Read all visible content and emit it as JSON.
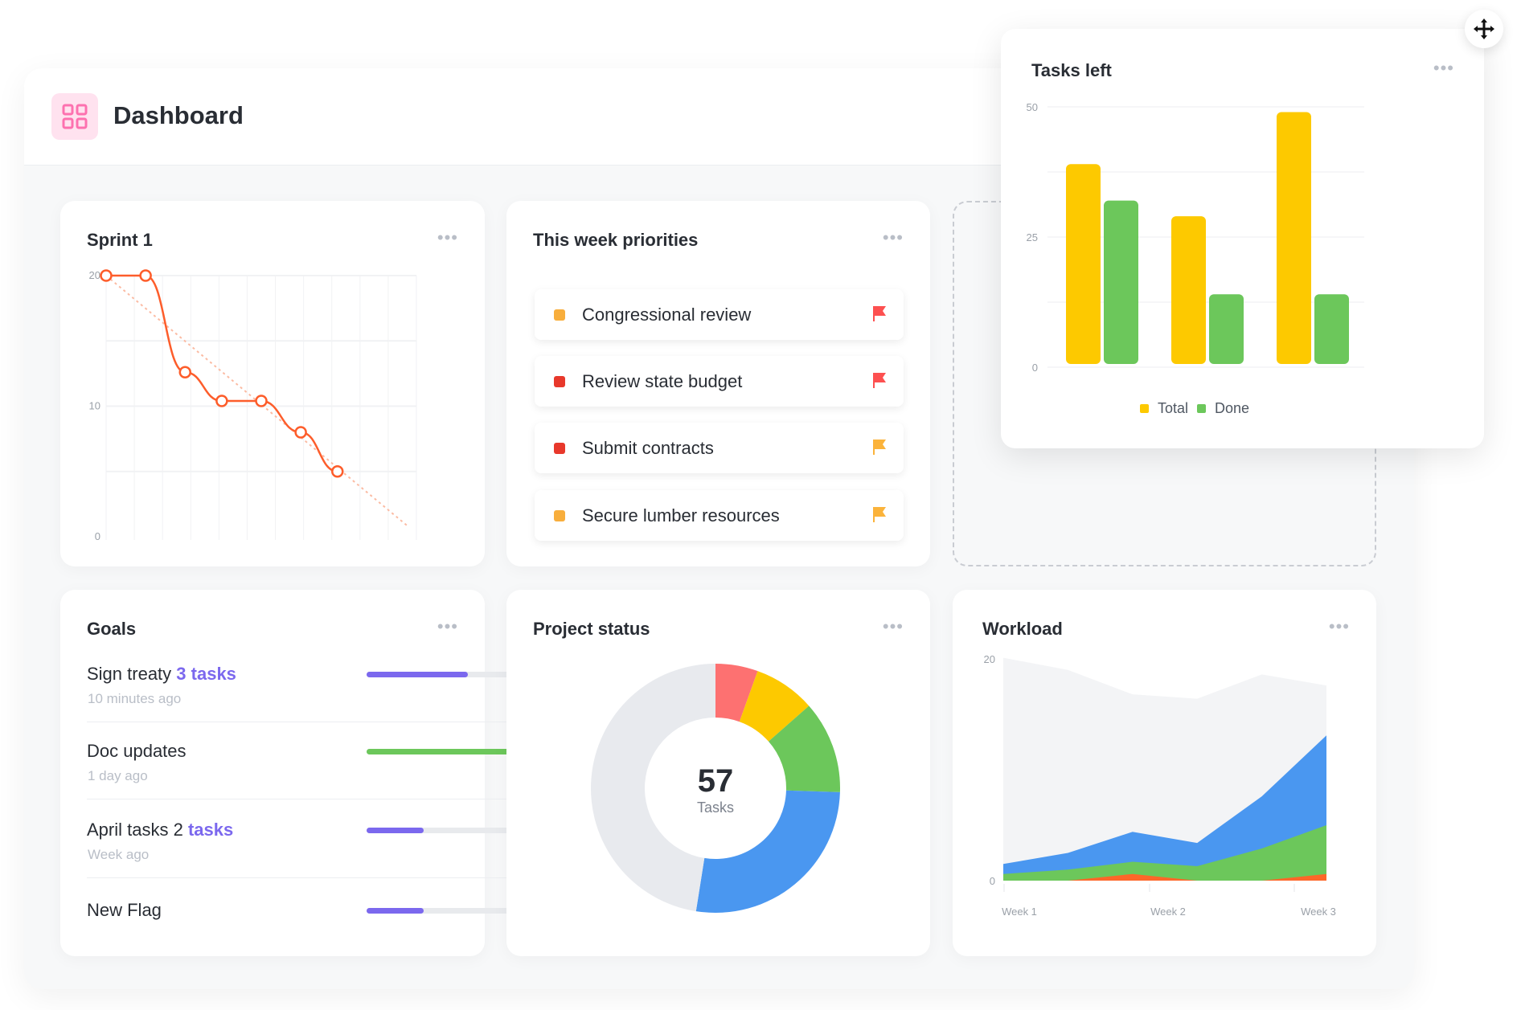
{
  "header": {
    "title": "Dashboard",
    "icon": "dashboard-grid-icon",
    "icon_color": "#fd71af"
  },
  "sprint": {
    "title": "Sprint 1",
    "menu": "•••",
    "chart_data": {
      "type": "line",
      "title": "Sprint 1",
      "yticks": [
        "0",
        "10",
        "20"
      ],
      "ylim": [
        0,
        20
      ],
      "xlim": [
        0,
        11
      ],
      "x": [
        0,
        1.4,
        2.8,
        4.1,
        5.5,
        6.9,
        8.2
      ],
      "y": [
        20,
        20,
        12.6,
        10.4,
        10.4,
        8,
        5
      ],
      "ideal": {
        "x": [
          0,
          10.7
        ],
        "y": [
          20,
          0.8
        ]
      },
      "color": "#fd5d2b",
      "grid": true
    }
  },
  "priorities": {
    "title": "This week priorities",
    "menu": "•••",
    "items": [
      {
        "label": "Congressional review",
        "status_color": "#f8ae3c",
        "flag_color": "#fd5050"
      },
      {
        "label": "Review state budget",
        "status_color": "#e8382b",
        "flag_color": "#fd5050"
      },
      {
        "label": "Submit contracts",
        "status_color": "#e8382b",
        "flag_color": "#fbb33b"
      },
      {
        "label": "Secure lumber resources",
        "status_color": "#f8ae3c",
        "flag_color": "#fbb33b"
      }
    ]
  },
  "tasks_left": {
    "title": "Tasks left",
    "menu": "•••",
    "chart_data": {
      "type": "bar",
      "categories": [
        "",
        "",
        ""
      ],
      "yticks": [
        "0",
        "25",
        "50"
      ],
      "ylim": [
        0,
        50
      ],
      "grid": true,
      "legend": "bottom",
      "series": [
        {
          "name": "Total",
          "values": [
            39,
            29,
            49
          ],
          "color": "#fdc900"
        },
        {
          "name": "Done",
          "values": [
            32,
            14,
            14
          ],
          "color": "#6cc75b"
        }
      ]
    }
  },
  "goals": {
    "title": "Goals",
    "menu": "•••",
    "items": [
      {
        "label": "Sign treaty",
        "link": "3 tasks",
        "time": "10 minutes ago",
        "progress": 0.67,
        "color": "#7b68ee"
      },
      {
        "label": "Doc updates",
        "link": "",
        "time": "1 day ago",
        "progress": 1.0,
        "color": "#6cc75b"
      },
      {
        "label": "April tasks 2",
        "link": "tasks",
        "time": "Week ago",
        "progress": 0.38,
        "color": "#7b68ee"
      },
      {
        "label": "New Flag",
        "link": "",
        "time": "",
        "progress": 0.38,
        "color": "#7b68ee"
      }
    ]
  },
  "project_status": {
    "title": "Project status",
    "menu": "•••",
    "total": "57",
    "total_label": "Tasks",
    "chart_data": {
      "type": "pie",
      "values": [
        5.5,
        8,
        12,
        27,
        47.5
      ],
      "colors": [
        "#fd7171",
        "#fdc900",
        "#6cc75b",
        "#4a97f0",
        "#e8eaee"
      ]
    }
  },
  "workload": {
    "title": "Workload",
    "menu": "•••",
    "chart_data": {
      "type": "area",
      "x_labels": [
        "Week 1",
        "Week 2",
        "Week 3"
      ],
      "yticks": [
        "0",
        "20"
      ],
      "ylim": [
        0,
        20
      ],
      "series": [
        {
          "values": [
            20.1,
            19,
            16.8,
            16.4,
            18.6,
            17.6
          ],
          "color": "#f3f4f6"
        },
        {
          "values": [
            1.5,
            2.5,
            4.4,
            3.4,
            7.6,
            13.1
          ],
          "color": "#4a97f0"
        },
        {
          "values": [
            0.6,
            1,
            1.7,
            1.3,
            2.9,
            5
          ],
          "color": "#6cc75b"
        },
        {
          "values": [
            0,
            0,
            0.6,
            0,
            0,
            0.6
          ],
          "color": "#fd6729"
        }
      ]
    }
  },
  "move_icon": "move-arrows-icon"
}
